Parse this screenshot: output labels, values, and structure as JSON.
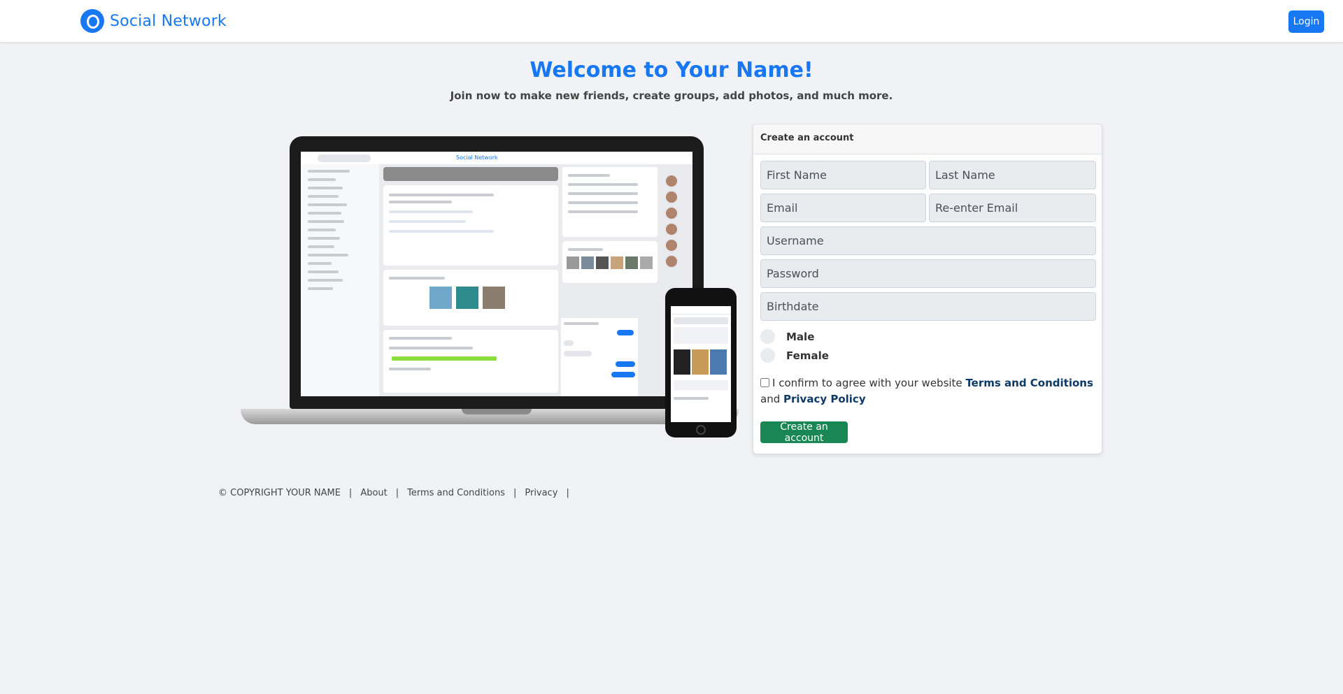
{
  "brand": {
    "name": "Social Network"
  },
  "nav": {
    "login_label": "Login"
  },
  "hero": {
    "title": "Welcome to Your Name!",
    "subtitle": "Join now to make new friends, create groups, add photos, and much more."
  },
  "form": {
    "header": "Create an account",
    "first_name_placeholder": "First Name",
    "last_name_placeholder": "Last Name",
    "email_placeholder": "Email",
    "reenter_email_placeholder": "Re-enter Email",
    "username_placeholder": "Username",
    "password_placeholder": "Password",
    "birthdate_placeholder": "Birthdate",
    "gender_options": [
      "Male",
      "Female"
    ],
    "agree_prefix": "I confirm to agree with your website",
    "terms_link": "Terms and Conditions",
    "agree_and": "and",
    "privacy_link": "Privacy Policy",
    "submit_label": "Create an account"
  },
  "footer": {
    "copyright": "© COPYRIGHT YOUR NAME",
    "links": [
      "About",
      "Terms and Conditions",
      "Privacy"
    ]
  },
  "illustration": {
    "mini_brand": "Social Network"
  },
  "colors": {
    "primary": "#1877f2",
    "success": "#198754",
    "background": "#f0f2f5",
    "link_dark": "#0d3a66"
  }
}
